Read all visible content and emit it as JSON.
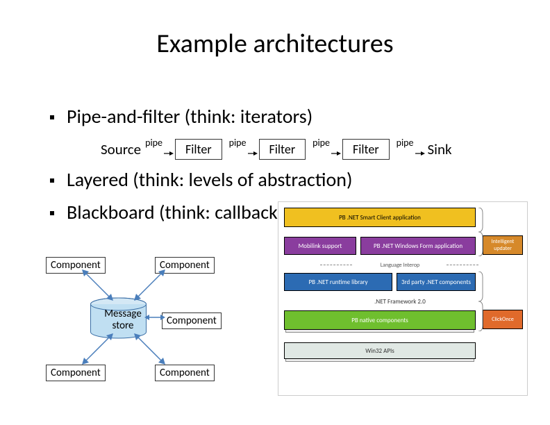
{
  "title": "Example architectures",
  "bullets": {
    "b1": "Pipe-and-filter (think: iterators)",
    "b2": "Layered (think: levels of abstraction)",
    "b3": "Blackboard (think: callbacks)"
  },
  "pipe": {
    "source": "Source",
    "filter": "Filter",
    "pipe": "pipe",
    "sink": "Sink"
  },
  "blackboard": {
    "component": "Component",
    "store": "Message store"
  },
  "layered": {
    "top": "PB .NET Smart Client application",
    "row2a": "Mobilink support",
    "row2b": "PB .NET Windows Form application",
    "row3a": "PB .NET runtime library",
    "row3b": "3rd party .NET components",
    "row4": "PB native components",
    "row5": "Win32 APIs",
    "right1": "Intelligent updater",
    "right2": "ClickOnce",
    "midlabel": "Language Interop",
    "framework": ".NET Framework 2.0"
  }
}
